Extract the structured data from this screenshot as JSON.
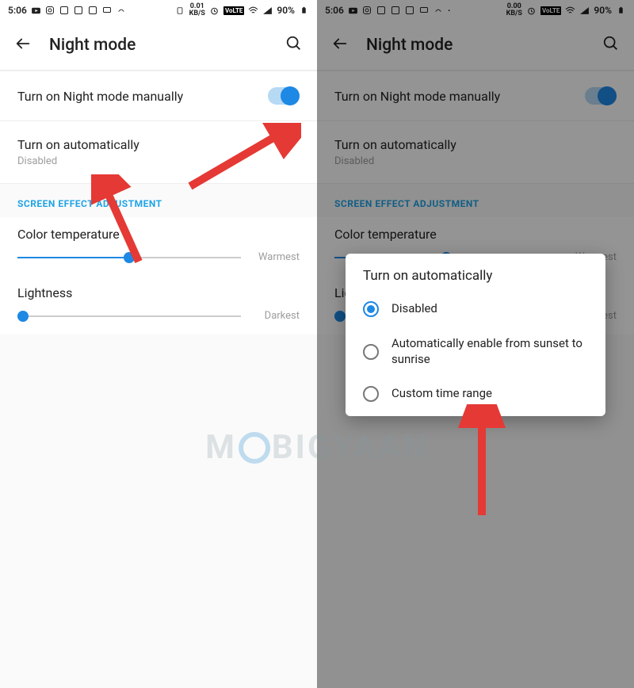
{
  "status": {
    "time": "5:06",
    "kbs_value": "0.01",
    "kbs_value2": "0.00",
    "kbs_unit": "KB/S",
    "volte": "VoLTE",
    "battery": "90%"
  },
  "header": {
    "title": "Night mode"
  },
  "rows": {
    "manual": "Turn on Night mode manually",
    "auto": "Turn on automatically",
    "auto_sub": "Disabled"
  },
  "section": "SCREEN EFFECT ADJUSTMENT",
  "sliders": {
    "color_temp": "Color temperature",
    "color_temp_end": "Warmest",
    "lightness": "Lightness",
    "lightness_end": "Darkest"
  },
  "dialog": {
    "title": "Turn on automatically",
    "opt1": "Disabled",
    "opt2": "Automatically enable from sunset to sunrise",
    "opt3": "Custom time range"
  },
  "watermark": {
    "part1": "M",
    "part2": "BIGYAAN"
  }
}
